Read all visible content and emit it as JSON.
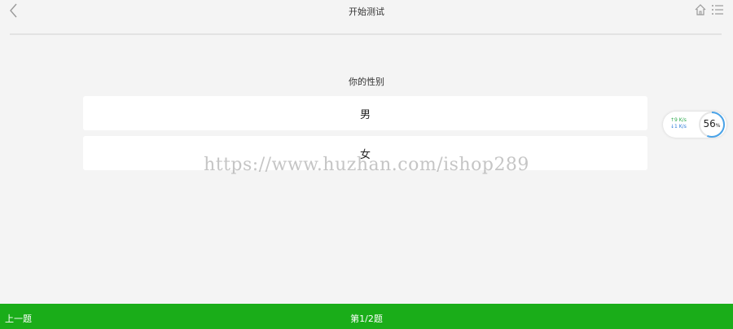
{
  "header": {
    "title": "开始测试",
    "back_icon": "chevron-left-icon",
    "home_icon": "home-icon",
    "menu_icon": "list-icon"
  },
  "question": {
    "text": "你的性别",
    "options": [
      "男",
      "女"
    ]
  },
  "watermark": "https://www.huzhan.com/ishop289",
  "speed_widget": {
    "upload": "↑9 K/s",
    "download": "↓1 K/s",
    "percent_value": "56",
    "percent_unit": "%",
    "ring_color": "#4aa3e8"
  },
  "footer": {
    "prev_label": "上一题",
    "progress": "第1/2题",
    "color": "#1aad19"
  }
}
